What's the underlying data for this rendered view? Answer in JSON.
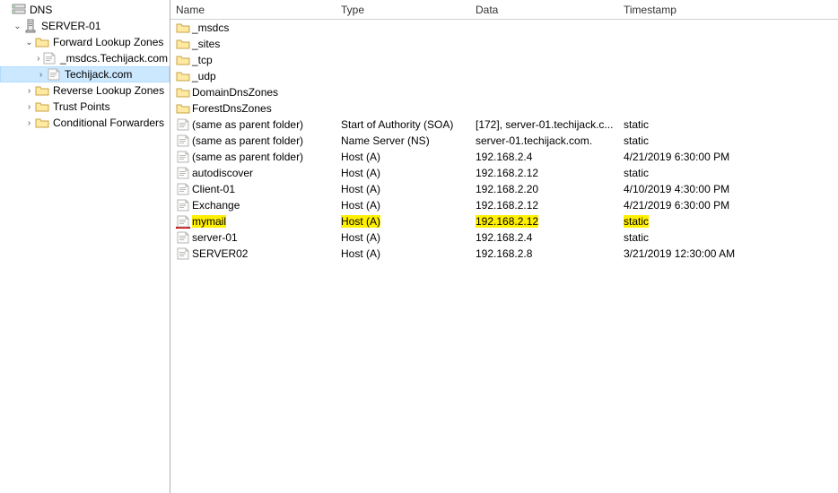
{
  "tree": {
    "root": "DNS",
    "server": "SERVER-01",
    "flz": "Forward Lookup Zones",
    "flz_children": [
      "_msdcs.Techijack.com",
      "Techijack.com"
    ],
    "rlz": "Reverse Lookup Zones",
    "trust": "Trust Points",
    "cond": "Conditional Forwarders"
  },
  "columns": {
    "name": "Name",
    "type": "Type",
    "data": "Data",
    "timestamp": "Timestamp"
  },
  "rows": [
    {
      "icon": "folder",
      "name": "_msdcs",
      "type": "",
      "data": "",
      "ts": ""
    },
    {
      "icon": "folder",
      "name": "_sites",
      "type": "",
      "data": "",
      "ts": ""
    },
    {
      "icon": "folder",
      "name": "_tcp",
      "type": "",
      "data": "",
      "ts": ""
    },
    {
      "icon": "folder",
      "name": "_udp",
      "type": "",
      "data": "",
      "ts": ""
    },
    {
      "icon": "folder",
      "name": "DomainDnsZones",
      "type": "",
      "data": "",
      "ts": ""
    },
    {
      "icon": "folder",
      "name": "ForestDnsZones",
      "type": "",
      "data": "",
      "ts": ""
    },
    {
      "icon": "rec",
      "name": "(same as parent folder)",
      "type": "Start of Authority (SOA)",
      "data": "[172], server-01.techijack.c...",
      "ts": "static"
    },
    {
      "icon": "rec",
      "name": "(same as parent folder)",
      "type": "Name Server (NS)",
      "data": "server-01.techijack.com.",
      "ts": "static"
    },
    {
      "icon": "rec",
      "name": "(same as parent folder)",
      "type": "Host (A)",
      "data": "192.168.2.4",
      "ts": "4/21/2019 6:30:00 PM"
    },
    {
      "icon": "rec",
      "name": "autodiscover",
      "type": "Host (A)",
      "data": "192.168.2.12",
      "ts": "static"
    },
    {
      "icon": "rec",
      "name": "Client-01",
      "type": "Host (A)",
      "data": "192.168.2.20",
      "ts": "4/10/2019 4:30:00 PM"
    },
    {
      "icon": "rec",
      "name": "Exchange",
      "type": "Host (A)",
      "data": "192.168.2.12",
      "ts": "4/21/2019 6:30:00 PM"
    },
    {
      "icon": "rec",
      "name": "mymail",
      "type": "Host (A)",
      "data": "192.168.2.12",
      "ts": "static",
      "highlight": true
    },
    {
      "icon": "rec",
      "name": "server-01",
      "type": "Host (A)",
      "data": "192.168.2.4",
      "ts": "static"
    },
    {
      "icon": "rec",
      "name": "SERVER02",
      "type": "Host (A)",
      "data": "192.168.2.8",
      "ts": "3/21/2019 12:30:00 AM"
    }
  ]
}
